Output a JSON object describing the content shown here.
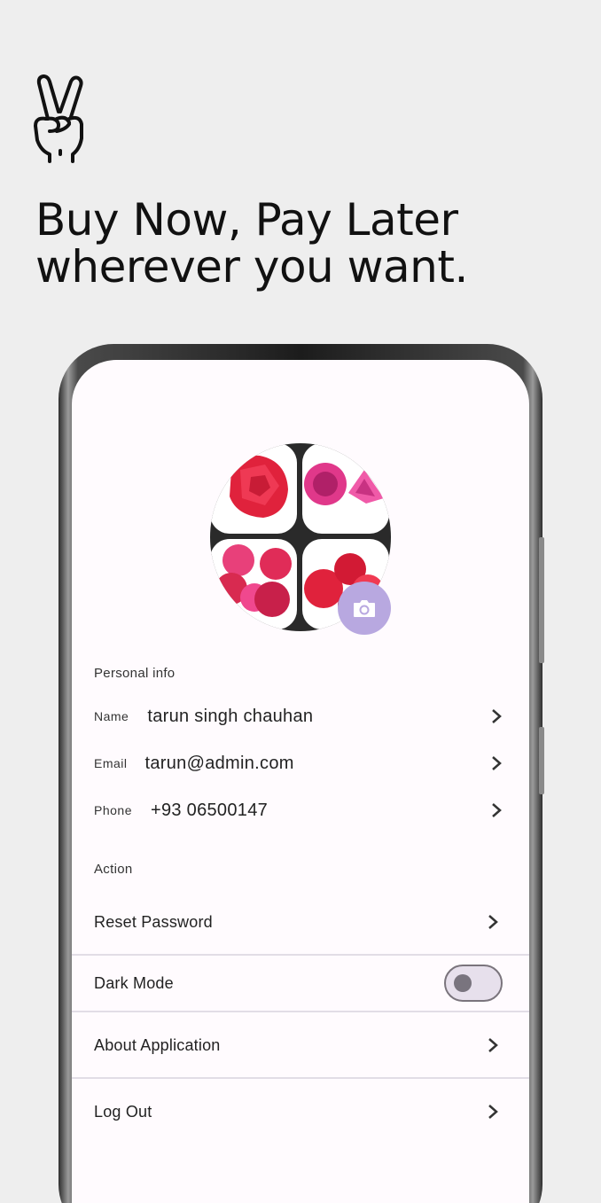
{
  "headline": {
    "line1": "Buy Now, Pay Later",
    "line2": "wherever you want."
  },
  "icons": {
    "hero": "peace-hand-icon",
    "camera": "camera-icon",
    "chevron": "chevron-right-icon"
  },
  "colors": {
    "background": "#eeeeee",
    "screen": "#fffbfe",
    "camera_button": "#b8a8e0"
  },
  "profile": {
    "avatar": "ruby-gemstones-avatar",
    "section_title": "Personal info",
    "fields": [
      {
        "label": "Name",
        "value": "tarun singh chauhan"
      },
      {
        "label": "Email",
        "value": "tarun@admin.com"
      },
      {
        "label": "Phone",
        "value": "+93 06500147"
      }
    ]
  },
  "actions": {
    "section_title": "Action",
    "items": [
      {
        "label": "Reset Password"
      },
      {
        "label": "Dark Mode",
        "toggle_on": false
      },
      {
        "label": "About Application"
      },
      {
        "label": "Log Out"
      }
    ]
  }
}
